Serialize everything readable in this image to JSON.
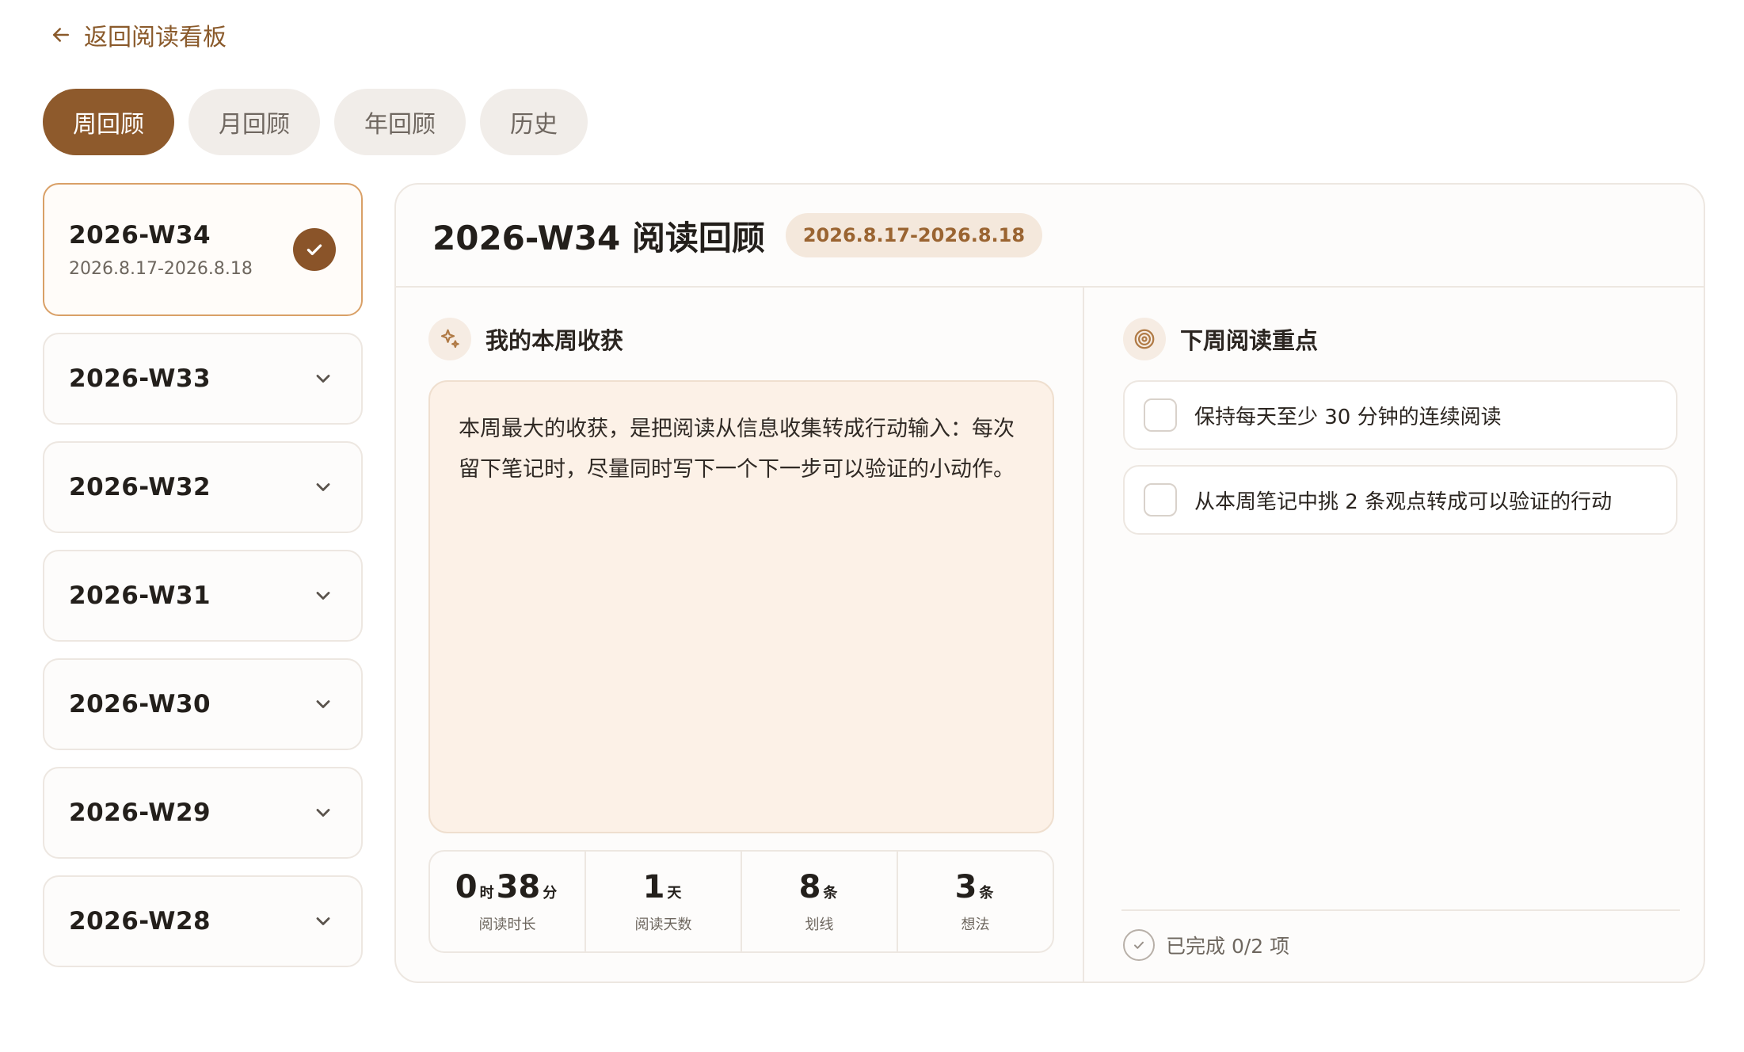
{
  "back_link": {
    "label": "返回阅读看板"
  },
  "tabs": [
    {
      "label": "周回顾",
      "active": true
    },
    {
      "label": "月回顾",
      "active": false
    },
    {
      "label": "年回顾",
      "active": false
    },
    {
      "label": "历史",
      "active": false
    }
  ],
  "weeks": [
    {
      "title": "2026-W34",
      "range": "2026.8.17-2026.8.18",
      "selected": true
    },
    {
      "title": "2026-W33"
    },
    {
      "title": "2026-W32"
    },
    {
      "title": "2026-W31"
    },
    {
      "title": "2026-W30"
    },
    {
      "title": "2026-W29"
    },
    {
      "title": "2026-W28"
    }
  ],
  "review": {
    "title": "2026-W34 阅读回顾",
    "date_range": "2026.8.17-2026.8.18",
    "gains_section": {
      "title": "我的本周收获",
      "text": "本周最大的收获，是把阅读从信息收集转成行动输入：每次留下笔记时，尽量同时写下一个下一步可以验证的小动作。"
    },
    "stats": [
      {
        "parts": [
          {
            "num": "0",
            "unit": "时"
          },
          {
            "num": "38",
            "unit": "分"
          }
        ],
        "label": "阅读时长"
      },
      {
        "parts": [
          {
            "num": "1",
            "unit": "天"
          }
        ],
        "label": "阅读天数"
      },
      {
        "parts": [
          {
            "num": "8",
            "unit": "条"
          }
        ],
        "label": "划线"
      },
      {
        "parts": [
          {
            "num": "3",
            "unit": "条"
          }
        ],
        "label": "想法"
      }
    ],
    "focus_section": {
      "title": "下周阅读重点",
      "items": [
        {
          "text": "保持每天至少 30 分钟的连续阅读",
          "checked": false
        },
        {
          "text": "从本周笔记中挑 2 条观点转成可以验证的行动",
          "checked": false
        }
      ],
      "progress_text": "已完成 0/2 项"
    }
  },
  "colors": {
    "accent": "#8e5a2c",
    "accent_light": "#f4e8dc",
    "gains_bg": "#fcf1e7",
    "border": "#ede7e1"
  }
}
